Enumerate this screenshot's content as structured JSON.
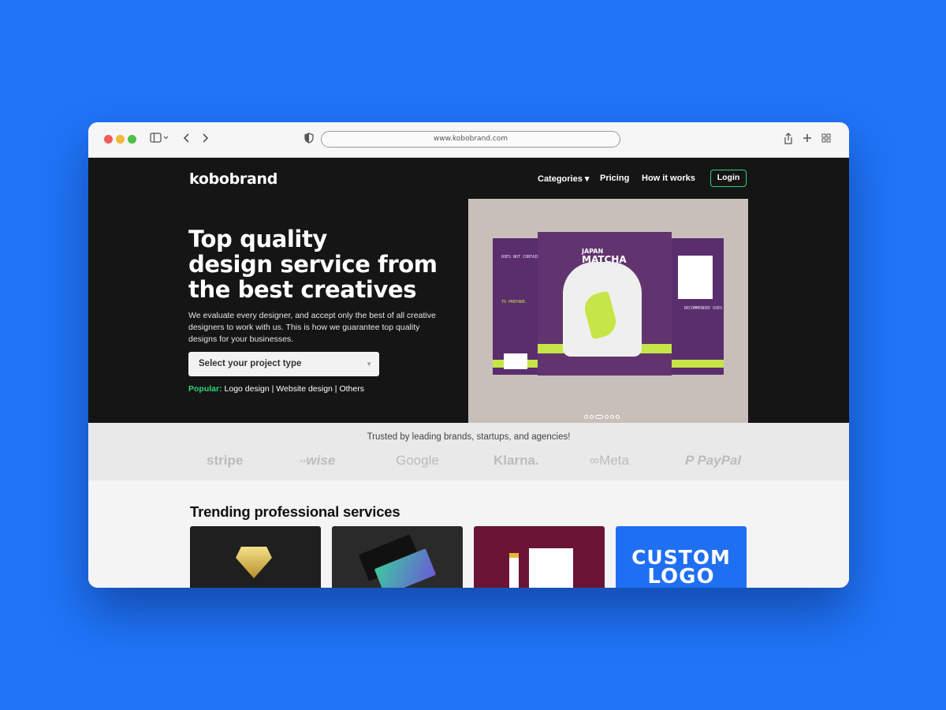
{
  "browser": {
    "url": "www.kobobrand.com",
    "icons": [
      "sidebar-icon",
      "chevron-left-icon",
      "chevron-right-icon",
      "shield-icon",
      "share-icon",
      "plus-icon",
      "tabs-grid-icon"
    ]
  },
  "site": {
    "logo": "kobobrand",
    "nav": {
      "categories": "Categories ▾",
      "pricing": "Pricing",
      "how": "How it works",
      "login": "Login"
    },
    "hero": {
      "headline_1": "Top quality",
      "headline_2": "design service from",
      "headline_3": "the best creatives",
      "subtext": "We evaluate every designer, and accept only the best of all creative designers to work with us. This is how we guarantee top quality designs for your businesses.",
      "select_label": "Select your project type",
      "popular_label": "Popular:",
      "popular_links": "Logo design | Website design | Others"
    },
    "hero_image": {
      "pack_title_1": "JAPAN",
      "pack_title_2": "MATCHA",
      "left_text": "DOES NOT CONTAIN",
      "left_text2": "TO PREPARE.",
      "right_text": "RECOMMENDED USES",
      "slides": 6,
      "active_slide": 3
    },
    "trusted": {
      "title": "Trusted by leading brands, startups, and agencies!",
      "brands": [
        "stripe",
        "wise",
        "Google",
        "Klarna.",
        "Meta",
        "PayPal"
      ]
    },
    "trending": {
      "title": "Trending professional services",
      "card4_line1": "CUSTOM",
      "card4_line2": "LOGO"
    }
  },
  "colors": {
    "background": "#1f74f7",
    "accent": "#2fd37a",
    "hero_bg": "#151515",
    "matcha_purple": "#5a2d6d",
    "matcha_lime": "#c6e547"
  }
}
